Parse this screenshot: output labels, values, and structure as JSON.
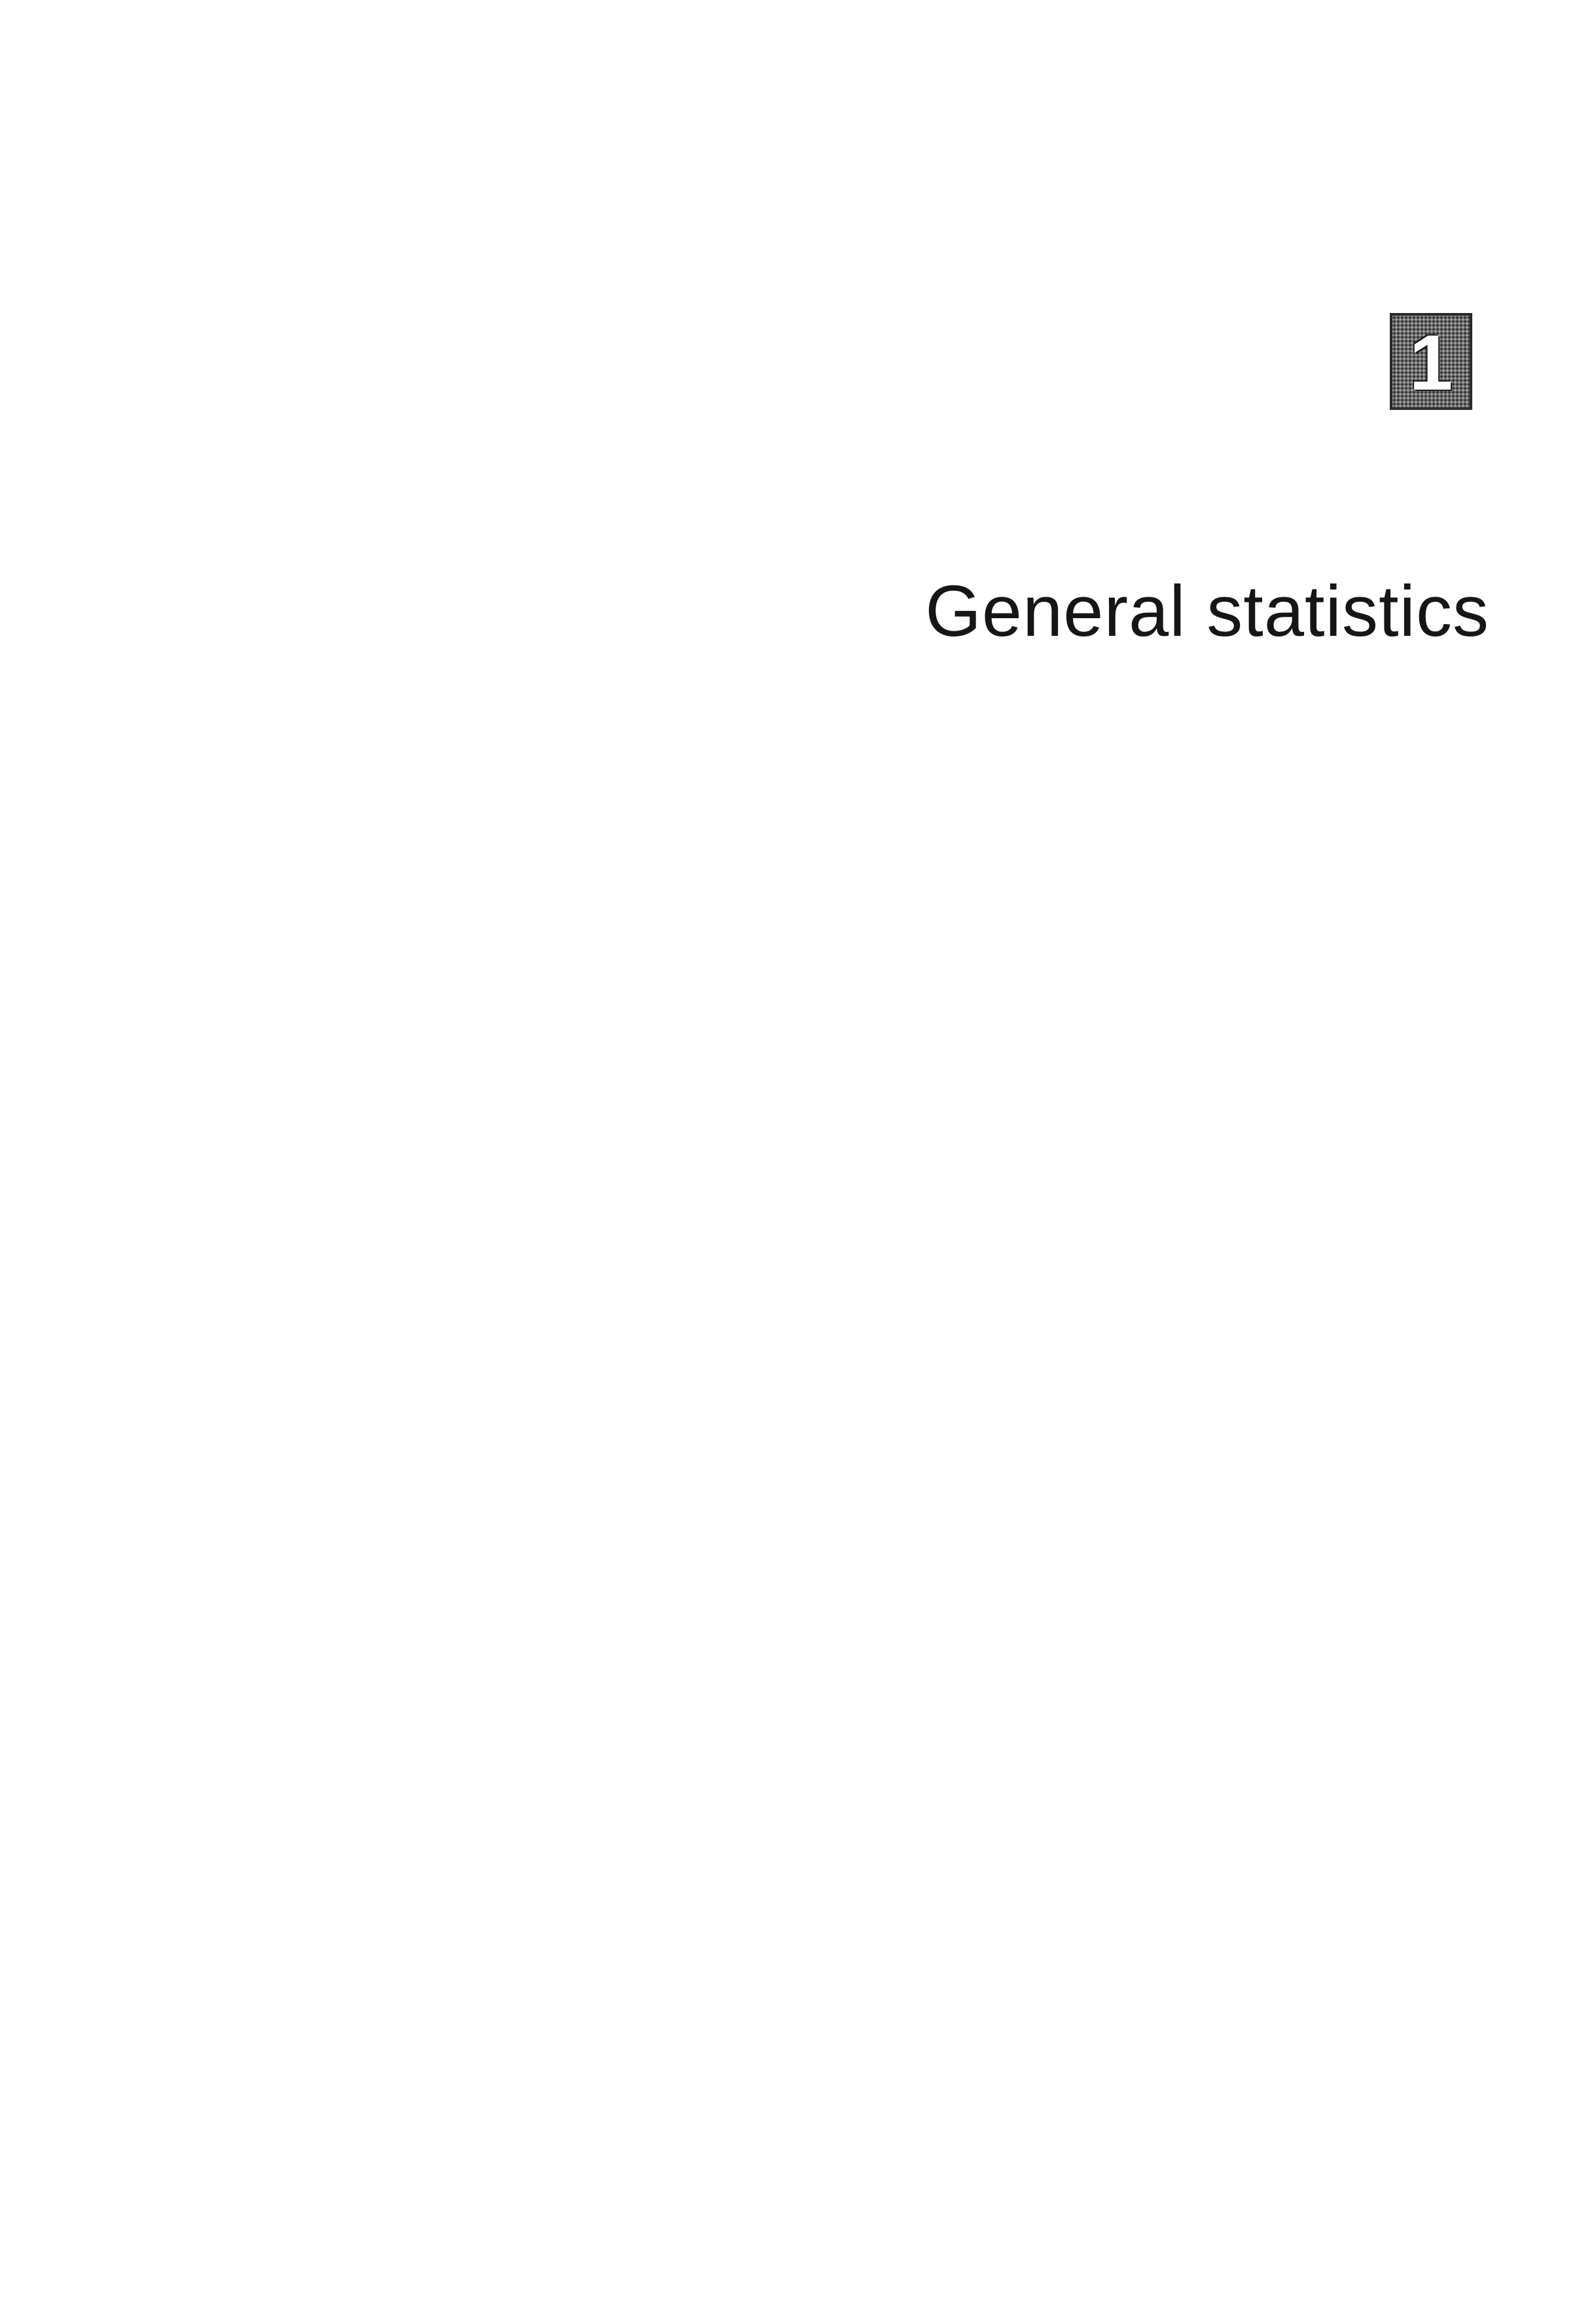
{
  "chapter": {
    "number": "1",
    "title": "General statistics"
  }
}
